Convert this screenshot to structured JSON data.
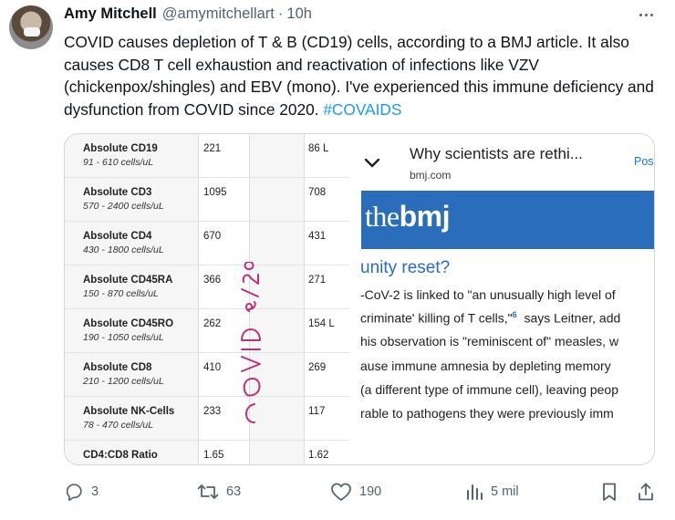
{
  "author": {
    "name": "Amy Mitchell",
    "handle": "@amymitchellart",
    "separator": "·",
    "time": "10h"
  },
  "tweet": {
    "text": "COVID causes depletion of T & B (CD19) cells, according to a BMJ article. It also causes CD8 T cell exhaustion and reactivation of infections like VZV (chickenpox/shingles) and EBV (mono). I've experienced this immune deficiency and dysfunction from COVID since 2020. ",
    "hashtag": "#COVAIDS"
  },
  "lab_table": {
    "rows": [
      {
        "name": "Absolute CD19",
        "range": "91 - 610 cells/uL",
        "before": "221",
        "after": "86 L"
      },
      {
        "name": "Absolute CD3",
        "range": "570 - 2400 cells/uL",
        "before": "1095",
        "after": "708"
      },
      {
        "name": "Absolute CD4",
        "range": "430 - 1800 cells/uL",
        "before": "670",
        "after": "431"
      },
      {
        "name": "Absolute CD45RA",
        "range": "150 - 870 cells/uL",
        "before": "366",
        "after": "271"
      },
      {
        "name": "Absolute CD45RO",
        "range": "190 - 1050 cells/uL",
        "before": "262",
        "after": "154 L"
      },
      {
        "name": "Absolute CD8",
        "range": "210 - 1200 cells/uL",
        "before": "410",
        "after": "269"
      },
      {
        "name": "Absolute NK-Cells",
        "range": "78 - 470 cells/uL",
        "before": "233",
        "after": "117"
      },
      {
        "name": "CD4:CD8 Ratio",
        "range": "",
        "before": "1.65",
        "after": "1.62"
      }
    ],
    "handwritten": "COVID 3/20",
    "ink_color": "#c0307a"
  },
  "link_card": {
    "title": "Why scientists are rethi...",
    "domain": "bmj.com",
    "post_label": "Pos",
    "logo_light": "the",
    "logo_bold": "bmj",
    "subheading": "unity reset?",
    "lines": [
      "-CoV-2 is linked to \"an unusually high level of",
      "criminate' killing of T cells,\"",
      "his observation is \"reminiscent of\" measles, w",
      "ause immune amnesia by depleting memory",
      "(a different type of immune cell), leaving peop",
      "rable to pathogens they were previously imm"
    ],
    "footnote": "6",
    "line2_tail": "says Leitner, add",
    "banner_color": "#2a6ebb"
  },
  "actions": {
    "replies": "3",
    "reposts": "63",
    "likes": "190",
    "views": "5 mil"
  },
  "colors": {
    "text": "#0f1419",
    "secondary": "#536471",
    "link": "#1d9bf0",
    "border": "#cfd9de"
  }
}
